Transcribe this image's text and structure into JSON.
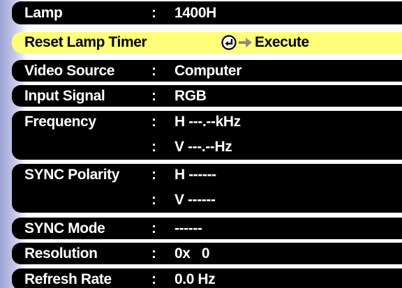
{
  "menu": {
    "rows": [
      {
        "id": "lamp",
        "label": "Lamp",
        "colon": ":",
        "value": "1400H"
      },
      {
        "id": "reset",
        "label": "Reset Lamp Timer",
        "action": "Execute",
        "selected": true,
        "icon": "enter-key-icon",
        "arrow": "right-arrow-icon"
      },
      {
        "id": "video-source",
        "label": "Video Source",
        "colon": ":",
        "value": "Computer"
      },
      {
        "id": "input-signal",
        "label": "Input Signal",
        "colon": ":",
        "value": "RGB"
      },
      {
        "id": "frequency",
        "label": "Frequency",
        "colon": ":",
        "value": "H ---.--kHz",
        "colon2": ":",
        "value2": "V ---.--Hz"
      },
      {
        "id": "sync-polarity",
        "label": "SYNC Polarity",
        "colon": ":",
        "value": "H ------",
        "colon2": ":",
        "value2": "V ------"
      },
      {
        "id": "sync-mode",
        "label": "SYNC Mode",
        "colon": ":",
        "value": "------"
      },
      {
        "id": "resolution",
        "label": "Resolution",
        "colon": ":",
        "value": "0x   0"
      },
      {
        "id": "refresh-rate",
        "label": "Refresh Rate",
        "colon": ":",
        "value": "0.0 Hz"
      }
    ]
  },
  "colors": {
    "row_background": "#000000",
    "row_text": "#ffffff",
    "selected_background": "#ffff77",
    "selected_text": "#000000",
    "side_gradient": "#9aa3d4"
  }
}
